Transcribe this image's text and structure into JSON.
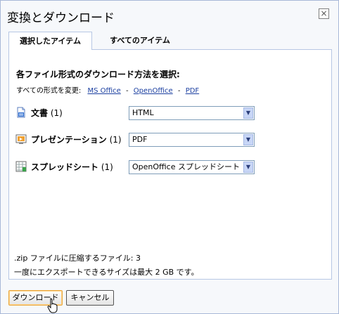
{
  "dialog": {
    "title": "変換とダウンロード",
    "close_symbol": "×"
  },
  "tabs": [
    {
      "label": "選択したアイテム",
      "active": true
    },
    {
      "label": "すべてのアイテム",
      "active": false
    }
  ],
  "format_section": {
    "heading": "各ファイル形式のダウンロード方法を選択:",
    "change_all_label": "すべての形式を変更:",
    "links": [
      "MS Office",
      "OpenOffice",
      "PDF"
    ],
    "separator": "-"
  },
  "rows": [
    {
      "label": "文書",
      "count": "(1)",
      "icon": "document-icon",
      "selected": "HTML"
    },
    {
      "label": "プレゼンテーション",
      "count": "(1)",
      "icon": "presentation-icon",
      "selected": "PDF"
    },
    {
      "label": "スプレッドシート",
      "count": "(1)",
      "icon": "spreadsheet-icon",
      "selected": "OpenOffice スプレッドシート"
    }
  ],
  "info": {
    "zip_line": ".zip ファイルに圧縮するファイル: 3",
    "size_line": "一度にエクスポートできるサイズは最大 2 GB です。"
  },
  "buttons": {
    "download": "ダウンロード",
    "cancel": "キャンセル"
  }
}
